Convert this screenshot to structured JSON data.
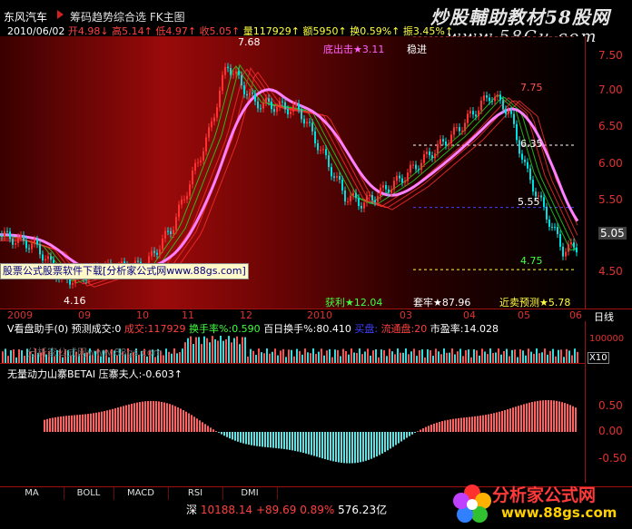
{
  "header": {
    "stock_name": "东风汽车",
    "modes": "筹码趋势综合选 FK主图",
    "watermark_line1": "炒股輔助教材58股网",
    "watermark_line2": "www.58Gu.com"
  },
  "quote": {
    "date": "2010/06/02",
    "open": "开4.98↓",
    "high": "高5.14↑",
    "low": "低4.97↑",
    "close": "收5.05↑",
    "volume": "量117929↑",
    "amount": "额5950↑",
    "turnover": "换0.59%↑",
    "amplitude": "振3.45%↑"
  },
  "annotations": {
    "peak_label": "7.68",
    "low_label": "4.16",
    "bottom_sig": "底出击★3.11",
    "stable": "稳进",
    "level_775": "7.75",
    "level_635": "6.35",
    "level_555": "5.55",
    "level_475": "4.75",
    "profit": "获利★12.04",
    "trapped": "套牢★87.96",
    "forecast": "近卖预测★5.78",
    "download": "股票公式股票软件下载[分析家公式网www.88gs.com]"
  },
  "price_axis": {
    "labels": [
      "7.50",
      "7.00",
      "6.50",
      "6.00",
      "5.50",
      "5.05",
      "4.50"
    ],
    "current": "5.05"
  },
  "dates": [
    "2009",
    "09",
    "10",
    "11",
    "12",
    "2010",
    "03",
    "04",
    "05",
    "06",
    "日线"
  ],
  "volume": {
    "title": "V看盘助手(0)",
    "forecast": "预测成交:0",
    "deal": "成交:117929",
    "turnover": "换手率%:0.590",
    "hundred_day": "百日换手%:80.410",
    "buy": "买盘:",
    "sell": "流通盘:20",
    "pe": "市盈率:14.028",
    "watermark": "分析家公式网www.88gs.com",
    "axis_label": "100000",
    "scale": "X10"
  },
  "indicator": {
    "title": "无量动力山寨BETAI",
    "pressure": "压寨夫人:-0.603↑",
    "axis": [
      "0.50",
      "0.00",
      "-0.50"
    ]
  },
  "tabs": [
    "MA",
    "BOLL",
    "MACD",
    "RSI",
    "DMI"
  ],
  "status": {
    "market": "深",
    "index": "10188.14",
    "change": "+89.69",
    "pct": "0.89%",
    "amount": "576.23亿"
  },
  "logo": {
    "text": "分析家公式网",
    "url": "www.88gs.com"
  },
  "colors": {
    "up": "#ff3030",
    "down": "#00e0e0",
    "ma_pink": "#ff80ff",
    "ma_teal": "#00c0c0",
    "grid": "#a01010"
  }
}
